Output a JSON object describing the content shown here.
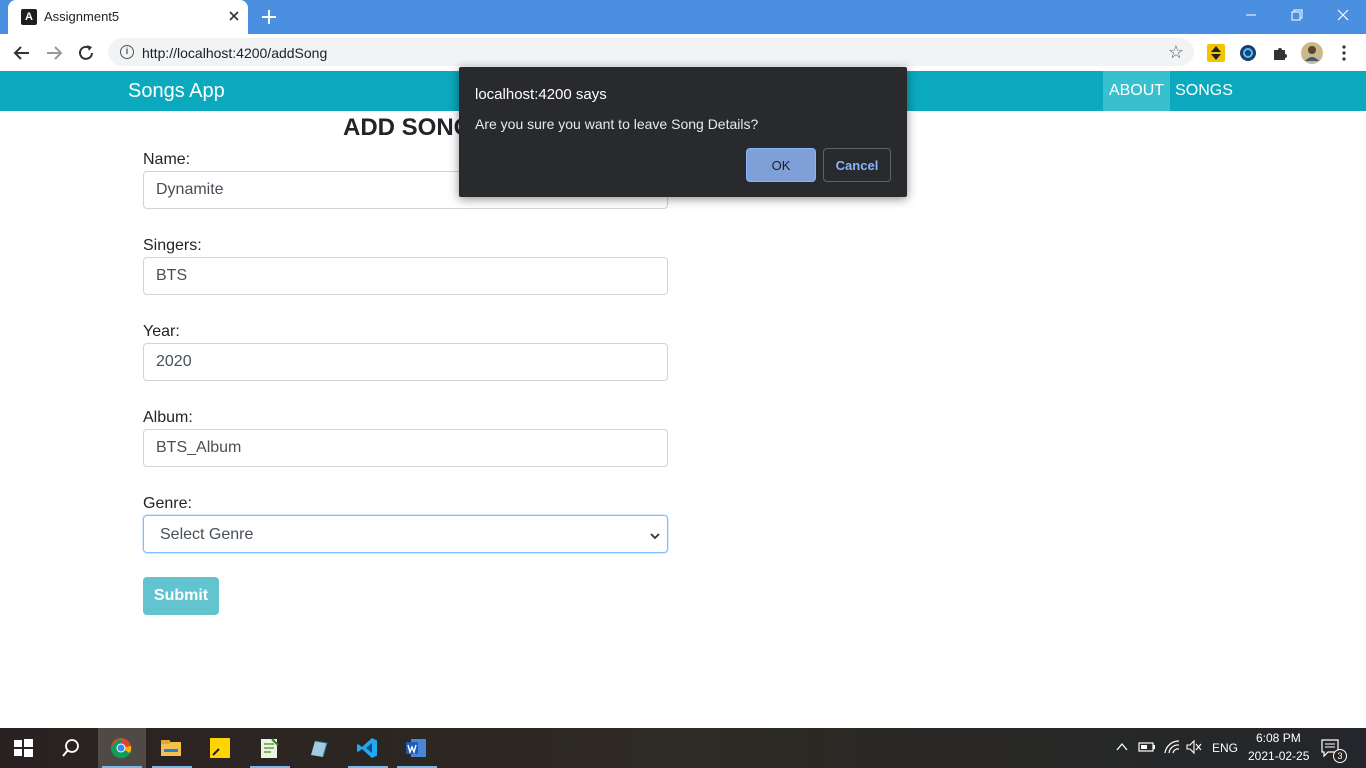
{
  "browser": {
    "tab_title": "Assignment5",
    "tab_favicon_letter": "A",
    "url": "http://localhost:4200/addSong"
  },
  "app": {
    "brand": "Songs App",
    "nav": {
      "about": "ABOUT",
      "songs": "SONGS"
    },
    "accent_color": "#0aa9bd"
  },
  "form": {
    "heading": "ADD SONG",
    "fields": {
      "name": {
        "label": "Name:",
        "value": "Dynamite"
      },
      "singers": {
        "label": "Singers:",
        "value": "BTS"
      },
      "year": {
        "label": "Year:",
        "value": "2020"
      },
      "album": {
        "label": "Album:",
        "value": "BTS_Album"
      },
      "genre": {
        "label": "Genre:",
        "selected": "Select Genre"
      }
    },
    "submit_label": "Submit"
  },
  "dialog": {
    "title": "localhost:4200 says",
    "message": "Are you sure you want to leave Song Details?",
    "ok_label": "OK",
    "cancel_label": "Cancel"
  },
  "taskbar": {
    "apps": [
      "start-icon",
      "search-icon",
      "chrome-icon",
      "file-explorer-icon",
      "sticky-notes-icon",
      "notepad-plus-icon",
      "snipping-tool-icon",
      "vscode-icon",
      "word-icon"
    ],
    "language": "ENG",
    "time": "6:08 PM",
    "date": "2021-02-25",
    "notification_count": "3"
  }
}
